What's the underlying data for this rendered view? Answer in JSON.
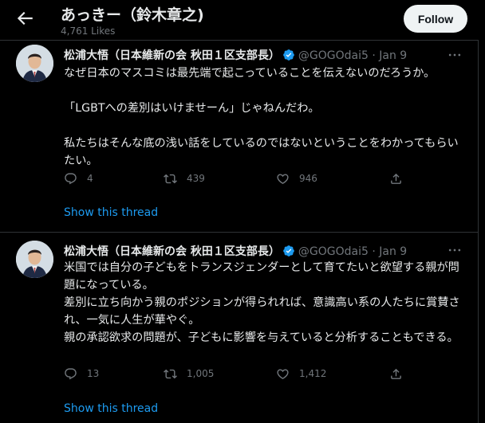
{
  "header": {
    "title": "あっきー（鈴木章之)",
    "subtitle": "4,761 Likes",
    "follow_label": "Follow"
  },
  "tweets": [
    {
      "author": "松浦大悟（日本維新の会 秋田１区支部長）",
      "handle": "@GOGOdai5",
      "separator": "·",
      "date": "Jan 9",
      "lines": [
        "なぜ日本のマスコミは最先端で起こっていることを伝えないのだろうか。",
        "「LGBTへの差別はいけませーん」じゃねんだわ。",
        "私たちはそんな底の浅い話をしているのではないということをわかってもらいたい。"
      ],
      "replies": "4",
      "retweets": "439",
      "likes": "946",
      "show_thread": "Show this thread"
    },
    {
      "author": "松浦大悟（日本維新の会 秋田１区支部長）",
      "handle": "@GOGOdai5",
      "separator": "·",
      "date": "Jan 9",
      "lines": [
        "米国では自分の子どもをトランスジェンダーとして育てたいと欲望する親が問題になっている。",
        "差別に立ち向かう親のポジションが得られれば、意識高い系の人たちに賞賛され、一気に人生が華やぐ。",
        "親の承認欲求の問題が、子どもに影響を与えていると分析することもできる。"
      ],
      "replies": "13",
      "retweets": "1,005",
      "likes": "1,412",
      "show_thread": "Show this thread"
    }
  ],
  "colors": {
    "background": "#000000",
    "text_primary": "#e7e9ea",
    "text_secondary": "#71767b",
    "link": "#1d9bf0",
    "verified": "#1d9bf0",
    "border": "#2f3336"
  },
  "icons": [
    "back-arrow-icon",
    "verified-badge-icon",
    "more-icon",
    "reply-icon",
    "retweet-icon",
    "like-icon",
    "share-icon"
  ]
}
